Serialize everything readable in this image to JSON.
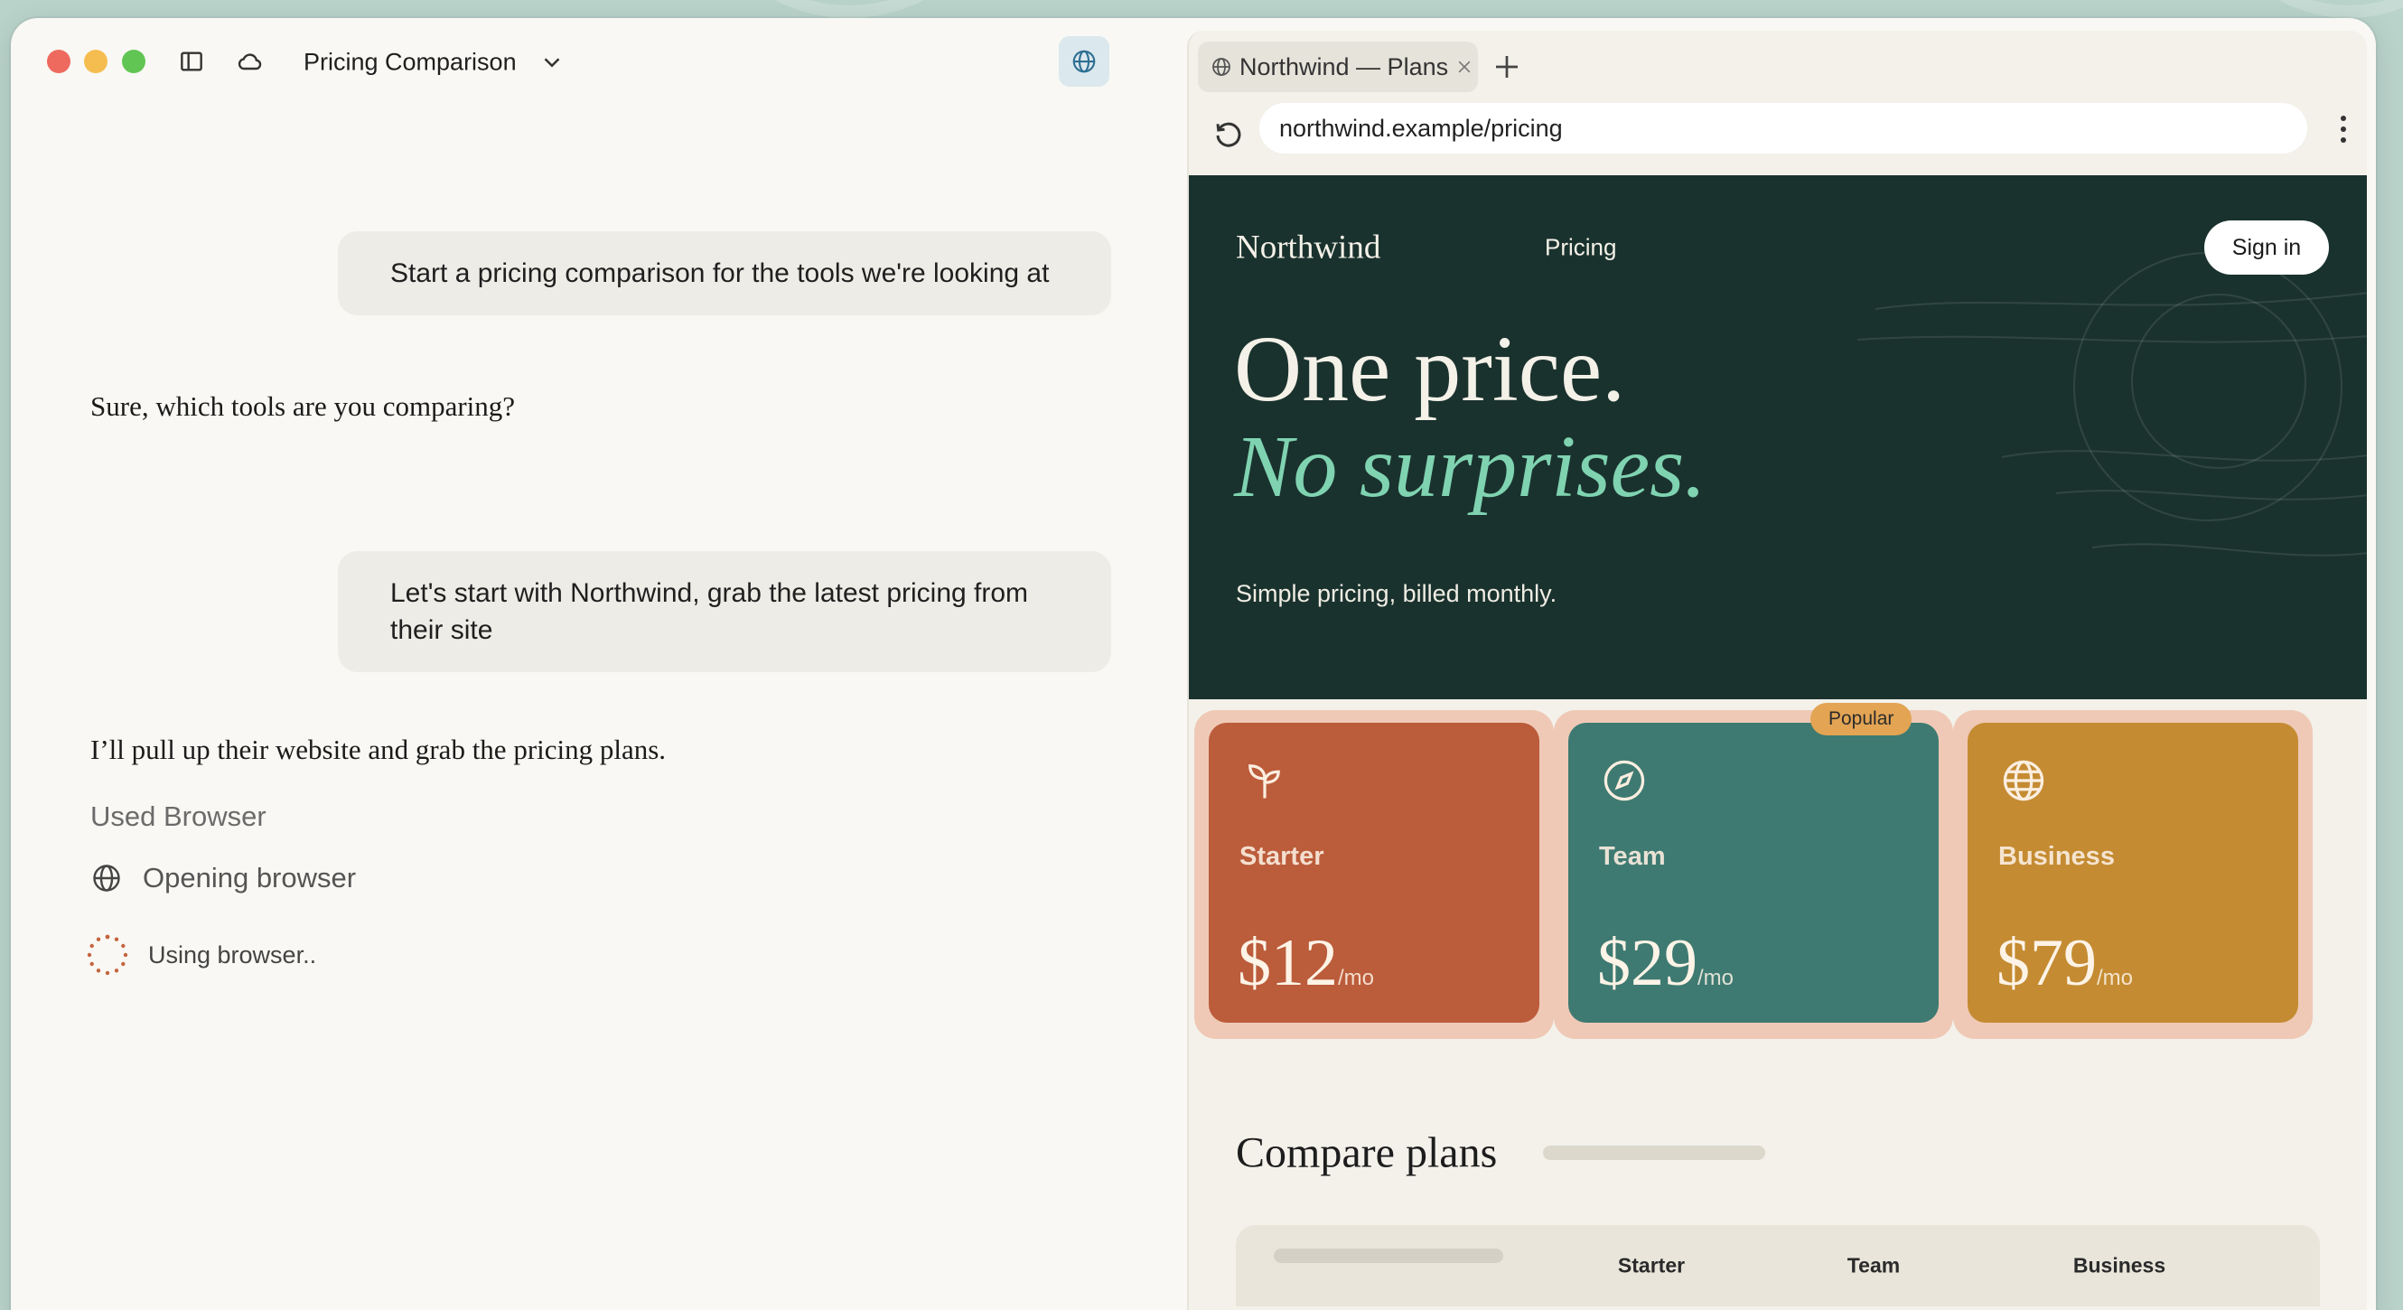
{
  "window": {
    "title": "Pricing Comparison"
  },
  "chat": {
    "messages": [
      {
        "role": "user",
        "text": "Start a pricing comparison for the tools we're looking at"
      },
      {
        "role": "assistant",
        "text": "Sure, which tools are you comparing?"
      },
      {
        "role": "user",
        "text": "Let's start with Northwind, grab the latest pricing from their site"
      },
      {
        "role": "assistant",
        "text": "I’ll pull up their website and grab the pricing plans."
      }
    ],
    "tool_header": "Used Browser",
    "steps": [
      {
        "icon": "globe-icon",
        "label": "Opening browser"
      },
      {
        "icon": "spinner-icon",
        "label": "Using browser.."
      }
    ]
  },
  "browser": {
    "tab_title": "Northwind — Plans",
    "url": "northwind.example/pricing"
  },
  "site": {
    "brand": "Northwind",
    "nav_pricing": "Pricing",
    "signin_label": "Sign in",
    "headline_line1": "One price.",
    "headline_line2": "No surprises.",
    "subline": "Simple pricing, billed monthly.",
    "popular_badge": "Popular",
    "plans": [
      {
        "name": "Starter",
        "price": "$12",
        "unit": "/mo",
        "icon": "sprout-icon",
        "color": "#bb5c3b"
      },
      {
        "name": "Team",
        "price": "$29",
        "unit": "/mo",
        "icon": "compass-icon",
        "color": "#3e7a72"
      },
      {
        "name": "Business",
        "price": "$79",
        "unit": "/mo",
        "icon": "globe-icon",
        "color": "#c48b32"
      }
    ],
    "compare_title": "Compare plans",
    "table_headers": [
      "Starter",
      "Team",
      "Business"
    ]
  },
  "colors": {
    "hero_bg": "#1a322e",
    "accent_green": "#7fd3b1",
    "popular_badge": "#e3a454",
    "plan_frame": "#efc9b6"
  }
}
